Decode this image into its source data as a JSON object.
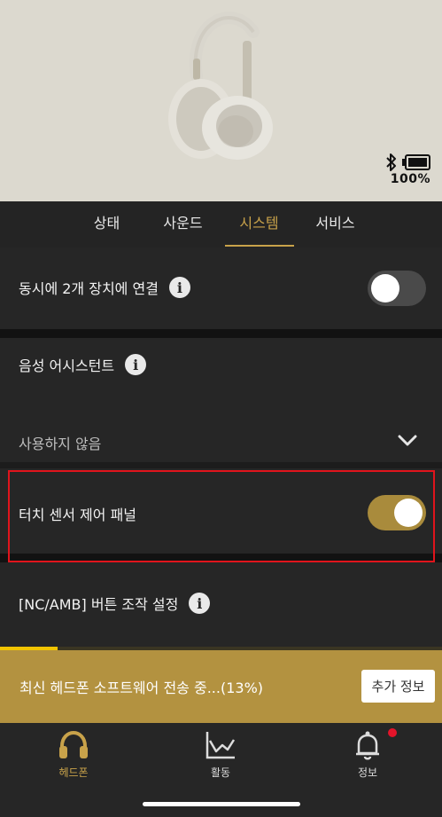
{
  "status": {
    "battery_percent": "100%"
  },
  "tabs": [
    {
      "label": "상태",
      "active": false
    },
    {
      "label": "사운드",
      "active": false
    },
    {
      "label": "시스템",
      "active": true
    },
    {
      "label": "서비스",
      "active": false
    }
  ],
  "settings": {
    "multipoint": {
      "label": "동시에 2개 장치에 연결",
      "enabled": false
    },
    "voice_assistant": {
      "label": "음성 어시스턴트",
      "value": "사용하지 않음"
    },
    "touch_panel": {
      "label": "터치 센서 제어 패널",
      "enabled": true
    },
    "nc_amb": {
      "label": "[NC/AMB] 버튼 조작 설정"
    }
  },
  "update_banner": {
    "text": "최신 헤드폰 소프트웨어 전송 중...(13%)",
    "progress": 0.13,
    "button_label": "추가 정보"
  },
  "bottom_nav": [
    {
      "label": "헤드폰",
      "icon": "headphones-icon",
      "active": true
    },
    {
      "label": "활동",
      "icon": "activity-chart-icon",
      "active": false
    },
    {
      "label": "정보",
      "icon": "bell-icon",
      "active": false,
      "badge": true
    }
  ],
  "colors": {
    "accent": "#c8a24a",
    "banner": "#b39240",
    "highlight_box": "#e0141c",
    "badge": "#e4142a"
  }
}
